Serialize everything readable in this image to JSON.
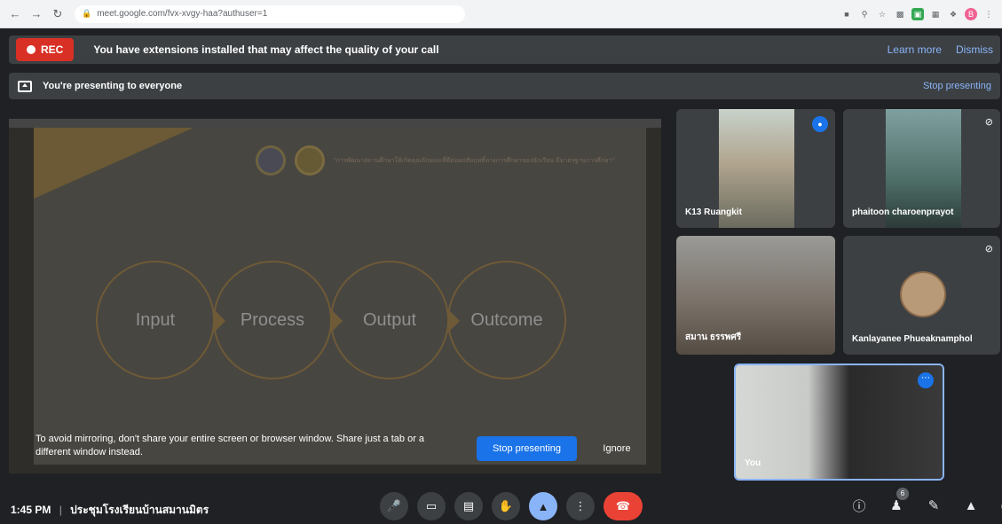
{
  "browser": {
    "url": "meet.google.com/fvx-xvgy-haa?authuser=1",
    "profile_initial": "B"
  },
  "banner": {
    "rec_label": "REC",
    "message": "You have extensions installed that may affect the quality of your call",
    "learn_more": "Learn more",
    "dismiss": "Dismiss"
  },
  "presenting": {
    "message": "You're presenting to everyone",
    "stop_label": "Stop presenting"
  },
  "shared_screen": {
    "slide_text": "\"การพัฒนาสถานศึกษาให้เกิดคุณลักษณะที่ดีต่อผลสัมฤทธิ์ทางการศึกษาของนักเรียน มีมาตรฐานการศึกษา\"",
    "circles": [
      "Input",
      "Process",
      "Output",
      "Outcome"
    ],
    "warning": "To avoid mirroring, don't share your entire screen or browser window. Share just a tab or a different window instead.",
    "stop_button": "Stop presenting",
    "ignore_button": "Ignore"
  },
  "participants": [
    {
      "name": "K13 Ruangkit",
      "status": "speaking"
    },
    {
      "name": "phaitoon charoenprayot",
      "status": "muted"
    },
    {
      "name": "สมาน ธรรพศรี",
      "status": "video"
    },
    {
      "name": "Kanlayanee Phueaknamphol",
      "status": "muted"
    },
    {
      "name": "You",
      "status": "self"
    }
  ],
  "footer": {
    "time": "1:45 PM",
    "separator": "|",
    "meeting_name": "ประชุมโรงเรียนบ้านสมานมิตร",
    "participant_count": "6"
  },
  "colors": {
    "accent": "#1a73e8",
    "link": "#8ab4f8",
    "rec": "#d93025",
    "end_call": "#ea4335",
    "background": "#202124"
  }
}
